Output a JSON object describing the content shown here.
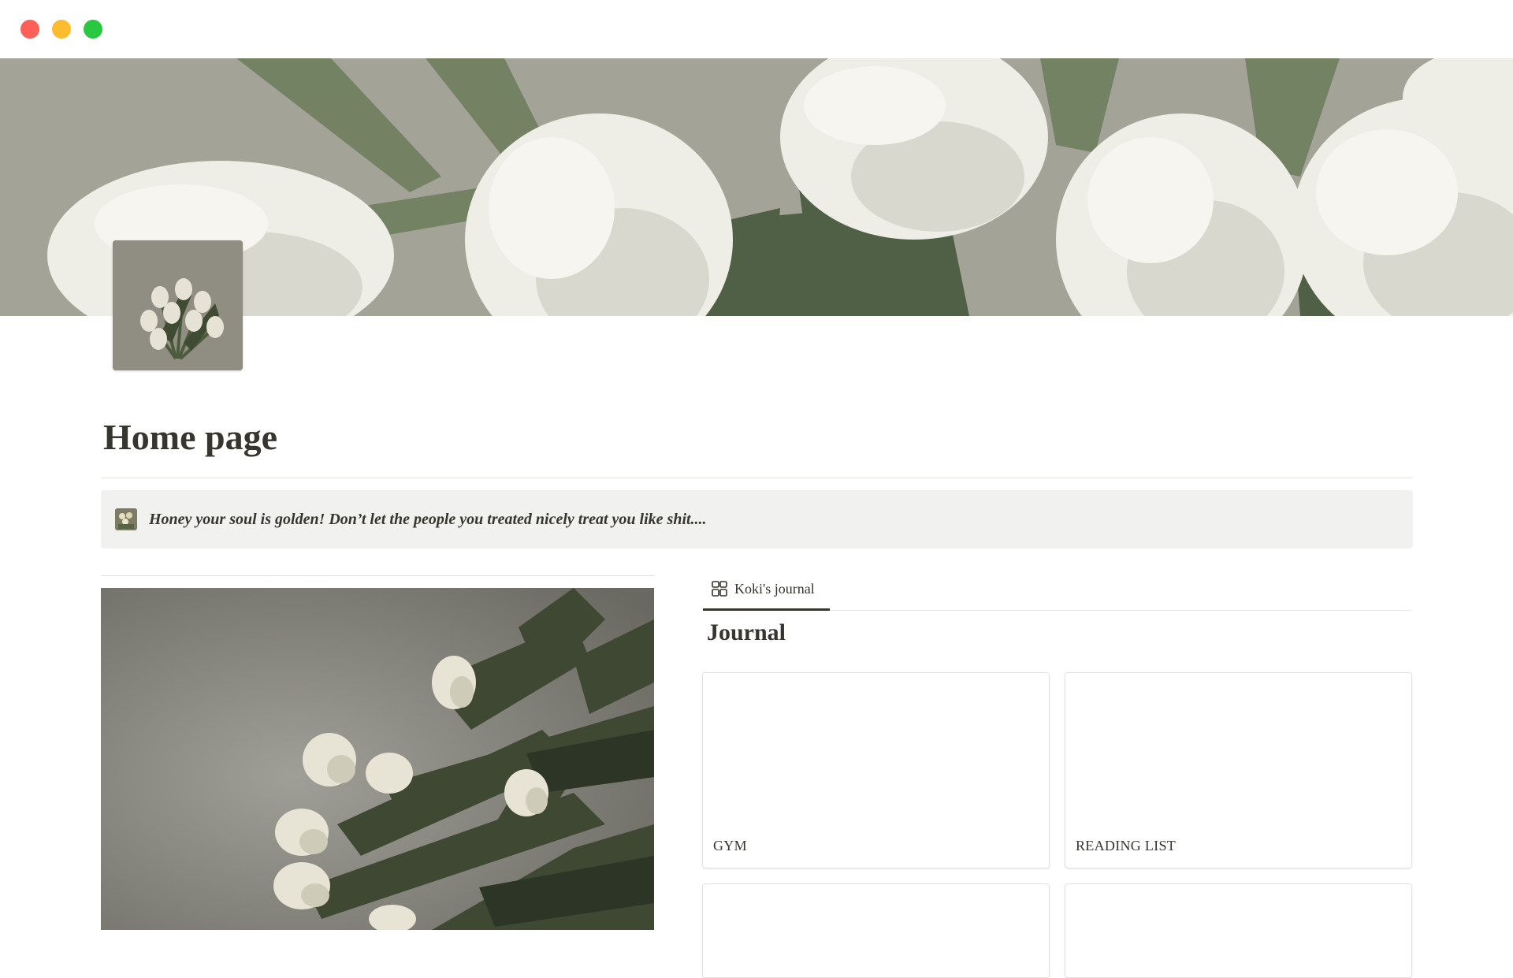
{
  "window": {
    "controls": [
      "close",
      "minimize",
      "maximize"
    ]
  },
  "page": {
    "title": "Home page",
    "cover_image": "white tulips photo",
    "icon_image": "tulip bouquet photo"
  },
  "callout": {
    "icon": "tulip-icon",
    "text": "Honey your soul is golden! Don’t let the people you treated nicely treat you like shit...."
  },
  "left_column": {
    "image": "tulips on grey background photo"
  },
  "database": {
    "tab_label": "Koki's journal",
    "tab_icon": "gallery-view-icon",
    "title": "Journal",
    "cards": [
      {
        "label": "GYM"
      },
      {
        "label": "READING LIST"
      },
      {
        "label": ""
      },
      {
        "label": ""
      }
    ]
  },
  "colors": {
    "text": "#37352f",
    "callout_bg": "#f1f1ef",
    "divider": "#e3e2de"
  }
}
